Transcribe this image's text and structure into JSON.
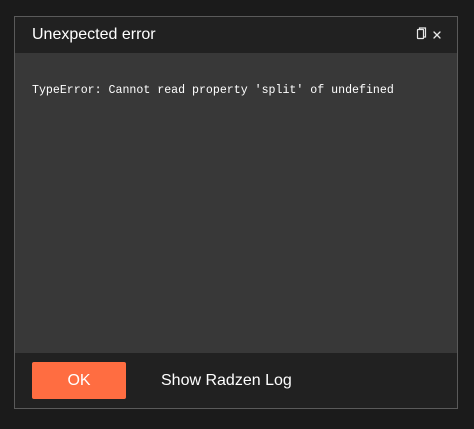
{
  "dialog": {
    "title": "Unexpected error",
    "message": "TypeError: Cannot read property 'split' of undefined",
    "icons": {
      "copy": "copy-icon",
      "close": "close-icon"
    }
  },
  "footer": {
    "ok_label": "OK",
    "log_label": "Show Radzen Log"
  },
  "colors": {
    "accent": "#ff6d41",
    "header_bg": "#212121",
    "content_bg": "#383838",
    "text": "#ffffff"
  }
}
